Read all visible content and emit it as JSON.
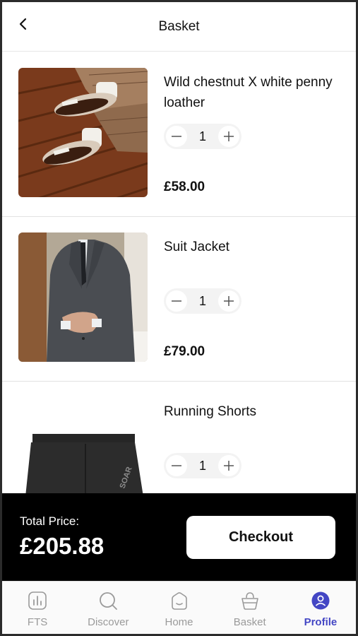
{
  "header": {
    "title": "Basket",
    "back_icon": "chevron-left-icon"
  },
  "items": [
    {
      "name": "Wild chestnut  X white penny loather",
      "quantity": "1",
      "price": "£58.00",
      "image": "loafer-shoes-photo"
    },
    {
      "name": "Suit Jacket",
      "quantity": "1",
      "price": "£79.00",
      "image": "suit-jacket-photo"
    },
    {
      "name": "Running Shorts",
      "quantity": "1",
      "price": "",
      "image": "running-shorts-photo",
      "image_text": "SOAR"
    }
  ],
  "checkout": {
    "total_label": "Total Price:",
    "total_value": "£205.88",
    "button_label": "Checkout"
  },
  "tabs": [
    {
      "label": "FTS",
      "icon": "bar-chart-icon",
      "active": false
    },
    {
      "label": "Discover",
      "icon": "search-icon",
      "active": false
    },
    {
      "label": "Home",
      "icon": "home-icon",
      "active": false
    },
    {
      "label": "Basket",
      "icon": "basket-icon",
      "active": false
    },
    {
      "label": "Profile",
      "icon": "profile-icon",
      "active": true
    }
  ],
  "colors": {
    "accent": "#4346c4",
    "checkout_bar": "#000000",
    "inactive_tab": "#9a9a9a"
  }
}
